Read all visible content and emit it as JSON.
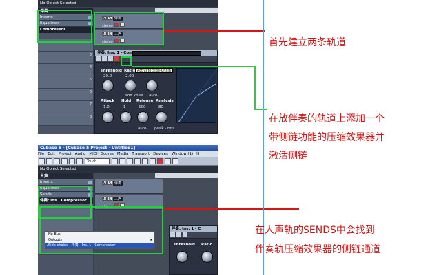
{
  "top_screenshot": {
    "status_text": "No Object Selected",
    "inspector": {
      "track_title": "伴奏",
      "sections": [
        "Inserts",
        "Equalizers"
      ],
      "insert_slot": "Compressor",
      "lane_numbers": [
        "2",
        "3",
        "4",
        "5",
        "6",
        "7",
        "8"
      ]
    },
    "tracks": [
      {
        "buttons": [
          "M",
          "S"
        ],
        "name": "伴奏"
      },
      {
        "buttons": [
          "M",
          "S"
        ],
        "name": "人声"
      }
    ],
    "track_output_label": "stereo",
    "plugin_window": {
      "title": "伴奏: Ins. 1 - Compressor",
      "tooltip": "Activate Side-Chain",
      "top_params": [
        "Threshold",
        "Ratio",
        "Attack"
      ],
      "top_values": [
        "-20.0",
        "2.00"
      ],
      "mode_labels": [
        "soft knee",
        "auto"
      ],
      "bottom_params": [
        "Attack",
        "Hold",
        "Release",
        "Analysis"
      ],
      "bottom_values": [
        "1.0",
        "1",
        "500",
        "80"
      ],
      "footer_labels": [
        "auto",
        "peak - rms"
      ]
    }
  },
  "bottom_screenshot": {
    "window_title": "Cubase 5 - [Cubase 5 Project - Untitled1]",
    "menu_items": [
      "File",
      "Edit",
      "Project",
      "Audio",
      "MIDI",
      "Scores",
      "Media",
      "Transport",
      "Devices",
      "Window (1)",
      "H"
    ],
    "touch_mode": "Touch",
    "status_text": "No Object Selected",
    "inspector": {
      "track_title": "人声",
      "sections": [
        "Inserts",
        "Equalizers",
        "Sends"
      ],
      "send_slot": "伴奏: Ins...Compressor"
    },
    "tracks": [
      {
        "buttons": [
          "M",
          "S"
        ],
        "name": "伴奏"
      },
      {
        "buttons": [
          "M",
          "S"
        ],
        "name": "人声"
      }
    ],
    "track_output_label": "stereo",
    "send_popup": {
      "items": [
        "No Bus",
        "Outputs",
        "Side-chains - 伴奏 - Ins. 1 - Compressor"
      ],
      "checked_index": 2
    },
    "plugin_window": {
      "title": "伴奏: Ins. 1 - C",
      "params": [
        "Threshold",
        "Ratio"
      ]
    }
  },
  "annotations": [
    "首先建立两条轨道",
    "在放伴奏的轨道上添加一个",
    "带侧链功能的压缩效果器并",
    "激活侧链",
    "在人声轨的SENDS中会找到",
    "伴奏轨压缩效果器的侧链通道"
  ],
  "colors": {
    "annotation_text": "#cf1515",
    "highlight_box": "#1fd436",
    "connector_red": "#d51717",
    "connector_green": "#2ecb3f",
    "divider_blue": "#5aa0d8",
    "cubase_panel": "#3a4352"
  }
}
